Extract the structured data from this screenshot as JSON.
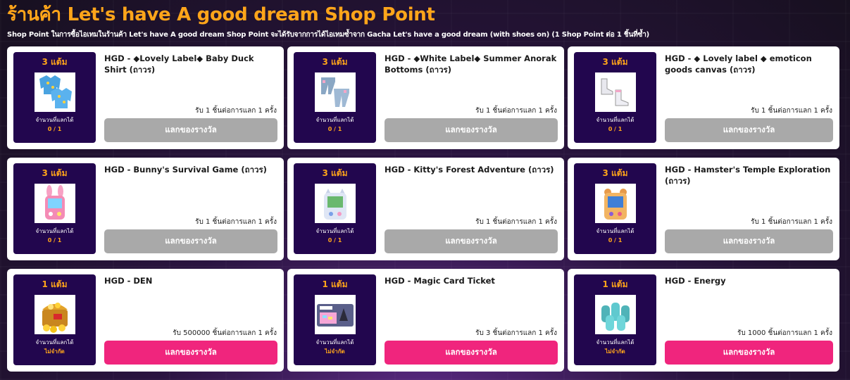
{
  "header": {
    "title": "ร้านค้า Let's have A good dream Shop Point",
    "subtitle": "Shop Point ในการซื้อไอเทมในร้านค้า Let's have A good dream Shop Point จะได้รับจากการได้ไอเทมซ้ำจาก Gacha Let's have a good dream (with shoes on) (1 Shop Point ต่อ 1 ชิ้นที่ซ้ำ)"
  },
  "labels": {
    "exchangeable": "จำนวนที่แลกได้",
    "redeem": "แลกของรางวัล"
  },
  "items": [
    {
      "points": "3 แต้ม",
      "name": "HGD - ◆Lovely Label◆ Baby Duck Shirt (ถาวร)",
      "receive": "รับ 1 ชิ้นต่อการแลก 1 ครั้ง",
      "count": "0 / 1",
      "icon": "shirt-icon",
      "enabled": false
    },
    {
      "points": "3 แต้ม",
      "name": "HGD - ◆White Label◆ Summer Anorak Bottoms (ถาวร)",
      "receive": "รับ 1 ชิ้นต่อการแลก 1 ครั้ง",
      "count": "0 / 1",
      "icon": "bottoms-icon",
      "enabled": false
    },
    {
      "points": "3 แต้ม",
      "name": "HGD - ◆ Lovely label ◆ emoticon goods canvas (ถาวร)",
      "receive": "รับ 1 ชิ้นต่อการแลก 1 ครั้ง",
      "count": "0 / 1",
      "icon": "shoes-icon",
      "enabled": false
    },
    {
      "points": "3 แต้ม",
      "name": "HGD - Bunny's Survival Game (ถาวร)",
      "receive": "รับ 1 ชิ้นต่อการแลก 1 ครั้ง",
      "count": "0 / 1",
      "icon": "bunny-console-icon",
      "enabled": false
    },
    {
      "points": "3 แต้ม",
      "name": "HGD - Kitty's Forest Adventure (ถาวร)",
      "receive": "รับ 1 ชิ้นต่อการแลก 1 ครั้ง",
      "count": "0 / 1",
      "icon": "kitty-console-icon",
      "enabled": false
    },
    {
      "points": "3 แต้ม",
      "name": "HGD - Hamster's Temple Exploration (ถาวร)",
      "receive": "รับ 1 ชิ้นต่อการแลก 1 ครั้ง",
      "count": "0 / 1",
      "icon": "hamster-console-icon",
      "enabled": false
    },
    {
      "points": "1 แต้ม",
      "name": "HGD - DEN",
      "receive": "รับ 500000 ชิ้นต่อการแลก 1 ครั้ง",
      "count": "ไม่จำกัด",
      "icon": "treasure-chest-icon",
      "enabled": true
    },
    {
      "points": "1 แต้ม",
      "name": "HGD - Magic Card Ticket",
      "receive": "รับ 3 ชิ้นต่อการแลก 1 ครั้ง",
      "count": "ไม่จำกัด",
      "icon": "magic-card-icon",
      "enabled": true
    },
    {
      "points": "1 แต้ม",
      "name": "HGD - Energy",
      "receive": "รับ 1000 ชิ้นต่อการแลก 1 ครั้ง",
      "count": "ไม่จำกัด",
      "icon": "energy-bottles-icon",
      "enabled": true
    }
  ],
  "colors": {
    "accent": "#ffa51a",
    "panel": "#22064e",
    "button_active": "#f0257d",
    "button_disabled": "#a9a9a9"
  }
}
